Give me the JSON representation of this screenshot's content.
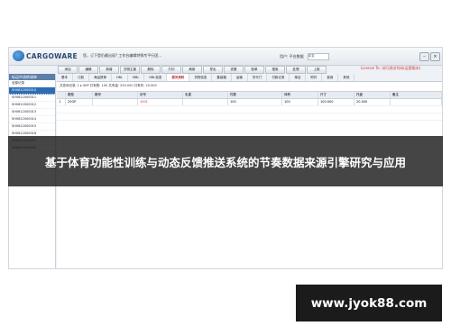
{
  "app": {
    "logo_text": "CARGOWARE",
    "notice": "您，订下是仍最出现? 工作台编辑特殊专平行团...",
    "user": "用户: 平台数据",
    "lang": "中文",
    "license": "License To: 试行测试号码(运营版本)"
  },
  "toolbar": {
    "buttons": [
      "添加",
      "编辑",
      "新增",
      "货物主管",
      "删除",
      "打印",
      "刷新",
      "导出",
      "查看",
      "账单",
      "搜索",
      "处理",
      "上报"
    ]
  },
  "sidebar": {
    "title": "标运中流转调单",
    "items": [
      "全部记录",
      "SH0612000010",
      "SH0612000011",
      "SH0612000012",
      "SH0612000013",
      "SH0612000014",
      "SH0612000015",
      "SH0612000016",
      "SH0612000017",
      "SH0612000018"
    ]
  },
  "tabs": [
    "基本",
    "订舱",
    "海运提单",
    "HBL",
    "MBL",
    "HBL信息",
    "报关资料",
    "货物信息",
    "集装箱",
    "运输",
    "货代门",
    "付款记录",
    "单证",
    "附件",
    "费用",
    "其他"
  ],
  "filter_text": "共查询记录: 1 ▸ 0KP 共有数: 100 共有量: 250.000 共有件: 20.000",
  "grid": {
    "headers": [
      "",
      "箱型",
      "箱号",
      "封号",
      "毛重",
      "件数",
      "体积",
      "尺寸",
      "托盘",
      "备注"
    ],
    "rows": [
      [
        "1",
        "20GP",
        "",
        "1001",
        "",
        "100",
        "100",
        "100.000",
        "20.000",
        ""
      ]
    ]
  },
  "banner_text": "基于体育功能性训练与动态反馈推送系统的节奏数据来源引擎研究与应用",
  "watermark_url": "www.jyok88.com"
}
